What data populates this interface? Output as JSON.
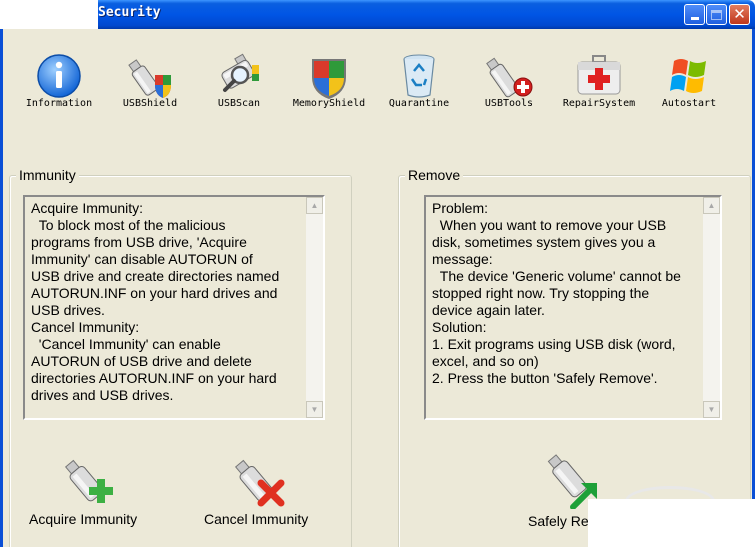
{
  "window": {
    "title": "Security",
    "min_glyph": "",
    "close_glyph": "✕"
  },
  "toolbar": {
    "items": [
      {
        "label": "Information",
        "icon": "info-icon"
      },
      {
        "label": "USBShield",
        "icon": "usb-shield-icon"
      },
      {
        "label": "USBScan",
        "icon": "usb-scan-icon"
      },
      {
        "label": "MemoryShield",
        "icon": "memory-shield-icon"
      },
      {
        "label": "Quarantine",
        "icon": "recycle-bin-icon"
      },
      {
        "label": "USBTools",
        "icon": "usb-tools-icon"
      },
      {
        "label": "RepairSystem",
        "icon": "first-aid-kit-icon"
      },
      {
        "label": "Autostart",
        "icon": "windows-flag-icon"
      }
    ]
  },
  "immunity": {
    "group_label": "Immunity",
    "text": "Acquire Immunity:\n  To block most of the malicious\nprograms from USB drive, 'Acquire\nImmunity' can disable AUTORUN of\nUSB drive and create directories named\nAUTORUN.INF on your hard drives and\nUSB drives.\nCancel Immunity:\n  'Cancel Immunity' can enable\nAUTORUN of USB drive and delete\ndirectories AUTORUN.INF on your hard\ndrives and USB drives.",
    "acquire_label": "Acquire Immunity",
    "cancel_label": "Cancel  Immunity"
  },
  "remove": {
    "group_label": "Remove",
    "text": "Problem:\n  When you want to remove your USB\ndisk, sometimes system gives you a\nmessage:\n  The device 'Generic volume' cannot be\nstopped right now. Try stopping the\ndevice again later.\nSolution:\n1. Exit programs using USB disk (word,\nexcel, and so on)\n2. Press the button 'Safely Remove'.",
    "safely_label": "Safely Re"
  },
  "scroll_up_glyph": "▲",
  "scroll_down_glyph": "▼",
  "colors": {
    "titlebar": "#0055e5",
    "face": "#ece9d8",
    "plus_green": "#3cb043",
    "cross_red": "#e03020"
  }
}
